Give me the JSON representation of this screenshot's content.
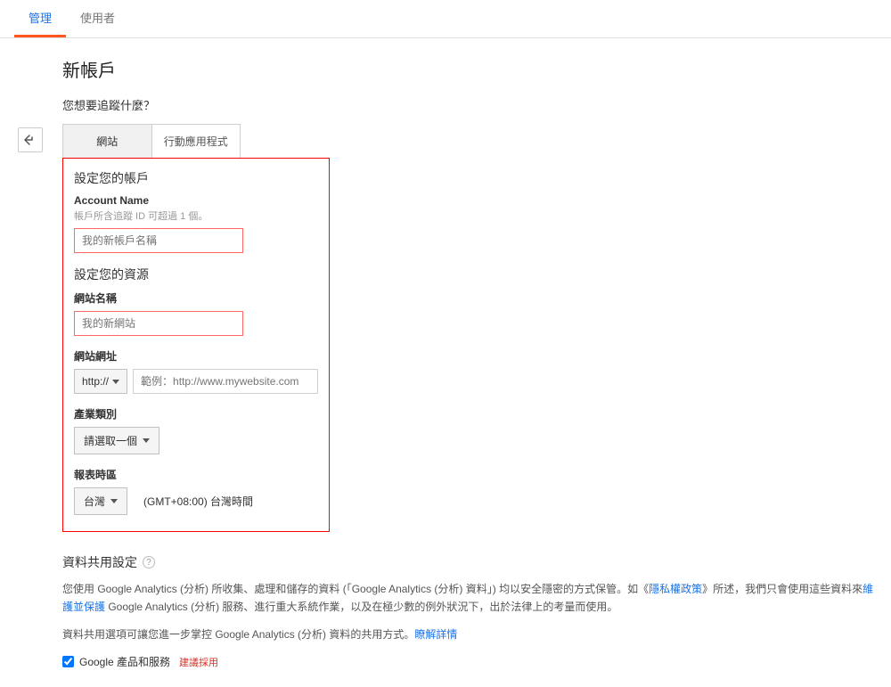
{
  "tabs": {
    "manage": "管理",
    "user": "使用者"
  },
  "page_title": "新帳戶",
  "track_prompt": "您想要追蹤什麼？",
  "track_tabs": {
    "website": "網站",
    "mobile_app": "行動應用程式"
  },
  "setup_account": {
    "heading": "設定您的帳戶",
    "account_name_label": "Account Name",
    "account_name_note": "帳戶所含追蹤 ID 可超過 1 個。",
    "account_name_placeholder": "我的新帳戶名稱"
  },
  "setup_property": {
    "heading": "設定您的資源",
    "site_name_label": "網站名稱",
    "site_name_placeholder": "我的新網站",
    "site_url_label": "網站網址",
    "protocol": "http://",
    "site_url_placeholder": "範例：http://www.mywebsite.com",
    "industry_label": "產業類別",
    "industry_value": "請選取一個",
    "timezone_label": "報表時區",
    "timezone_country": "台灣",
    "timezone_display": "(GMT+08:00) 台灣時間"
  },
  "share": {
    "heading": "資料共用設定",
    "para1_a": "您使用 Google Analytics (分析) 所收集、處理和儲存的資料 (「Google Analytics (分析) 資料」) 均以安全隱密的方式保管。如《",
    "privacy_link": "隱私權政策",
    "para1_b": "》所述，我們只會使用這些資料來",
    "maintain_link": "維護並保護",
    "para1_c": " Google Analytics (分析) 服務、進行重大系統作業，以及在極少數的例外狀況下，出於法律上的考量而使用。",
    "para2_a": "資料共用選項可讓您進一步掌控 Google Analytics (分析) 資料的共用方式。",
    "details_link": "瞭解詳情",
    "checkbox_label": "Google 產品和服務",
    "recommended": "建議採用"
  }
}
